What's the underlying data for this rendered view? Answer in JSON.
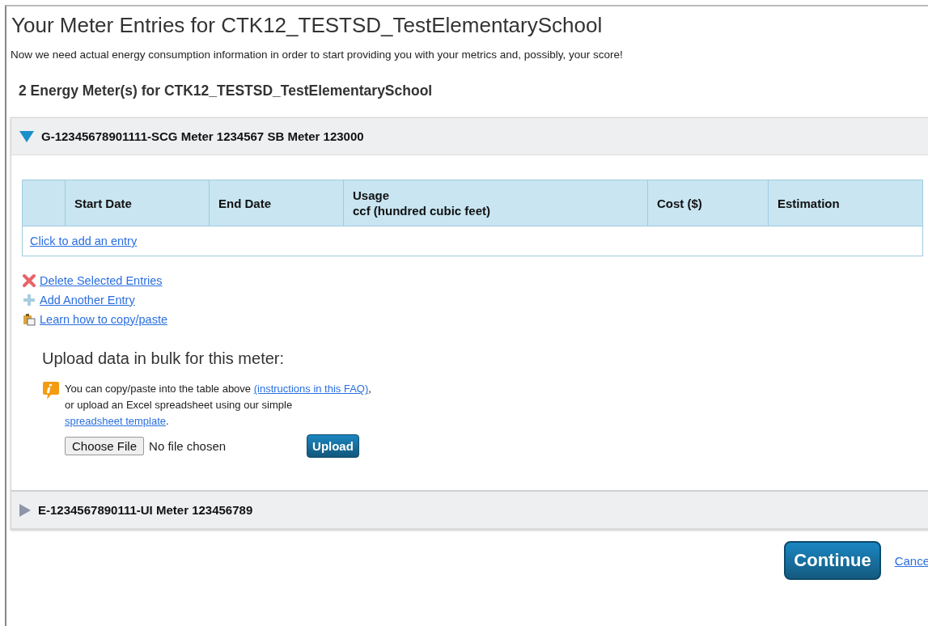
{
  "page_title": "Your Meter Entries for CTK12_TESTSD_TestElementarySchool",
  "intro": "Now we need actual energy consumption information in order to start providing you with your metrics and, possibly, your score!",
  "meters_heading": "2 Energy Meter(s) for CTK12_TESTSD_TestElementarySchool",
  "meters": [
    {
      "title": "G-12345678901111-SCG Meter 1234567 SB Meter 123000",
      "expanded": true,
      "table": {
        "columns": [
          "Start Date",
          "End Date",
          "Usage\nccf (hundred cubic feet)",
          "Cost ($)",
          "Estimation"
        ],
        "add_entry_link": "Click to add an entry"
      },
      "actions": [
        {
          "kind": "delete",
          "label": "Delete Selected Entries"
        },
        {
          "kind": "add",
          "label": "Add Another Entry"
        },
        {
          "kind": "help",
          "label": "Learn how to copy/paste"
        }
      ],
      "upload": {
        "heading": "Upload data in bulk for this meter:",
        "info": [
          {
            "kind": "text",
            "text": "You can copy/paste into the table above "
          },
          {
            "kind": "link",
            "text": "(instructions in this FAQ)"
          },
          {
            "kind": "text",
            "text": ", or upload an Excel spreadsheet using our simple "
          },
          {
            "kind": "link",
            "text": "spreadsheet template"
          },
          {
            "kind": "text",
            "text": "."
          }
        ],
        "choose_button": "Choose File",
        "file_status": "No file chosen",
        "upload_button": "Upload"
      }
    },
    {
      "title": "E-1234567890111-UI Meter 123456789",
      "expanded": false
    }
  ],
  "footer": {
    "continue_button": "Continue",
    "cancel_link": "Cance"
  }
}
